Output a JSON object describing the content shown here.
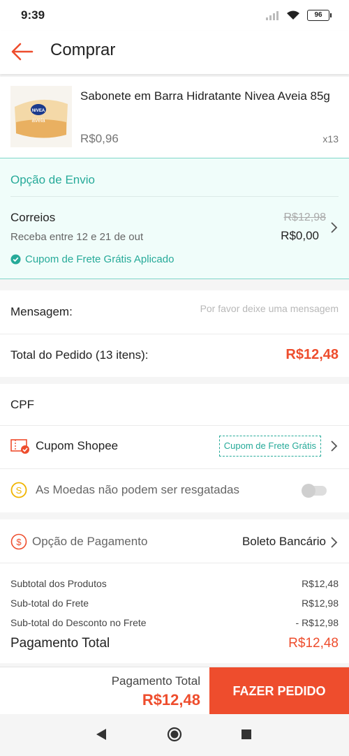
{
  "status": {
    "time": "9:39",
    "battery": "96"
  },
  "header": {
    "title": "Comprar"
  },
  "product": {
    "name": "Sabonete em Barra Hidratante Nivea Aveia 85g",
    "price": "R$0,96",
    "quantity": "x13",
    "image_brand": "NIVEA",
    "image_variant": "aveia"
  },
  "shipping": {
    "header": "Opção de Envio",
    "carrier": "Correios",
    "delivery": "Receba entre 12 e 21 de out",
    "old_price": "R$12,98",
    "new_price": "R$0,00",
    "coupon_applied": "Cupom de Frete Grátis Aplicado"
  },
  "message": {
    "label": "Mensagem:",
    "placeholder": "Por favor deixe uma mensagem"
  },
  "order_total": {
    "label": "Total do Pedido (13 itens):",
    "value": "R$12,48"
  },
  "cpf": {
    "label": "CPF"
  },
  "voucher": {
    "label": "Cupom Shopee",
    "chip": "Cupom de Frete Grátis"
  },
  "coins": {
    "label": "As Moedas não podem ser resgatadas",
    "enabled": false
  },
  "payment": {
    "label": "Opção de Pagamento",
    "value": "Boleto Bancário"
  },
  "summary": {
    "lines": [
      {
        "label": "Subtotal dos Produtos",
        "value": "R$12,48"
      },
      {
        "label": "Sub-total do Frete",
        "value": "R$12,98"
      },
      {
        "label": "Sub-total do Desconto no Frete",
        "value": "- R$12,98"
      }
    ],
    "total_label": "Pagamento Total",
    "total_value": "R$12,48"
  },
  "bottom_bar": {
    "label": "Pagamento Total",
    "total": "R$12,48",
    "button": "FAZER PEDIDO"
  },
  "colors": {
    "accent": "#ee4d2d",
    "teal": "#26aa99",
    "shipping_bg": "#f0fdfa"
  },
  "icons": [
    "back-arrow-icon",
    "check-circle-icon",
    "chevron-right-icon",
    "voucher-icon",
    "coins-icon",
    "dollar-circle-icon",
    "nav-back-icon",
    "nav-home-icon",
    "nav-recent-icon"
  ]
}
